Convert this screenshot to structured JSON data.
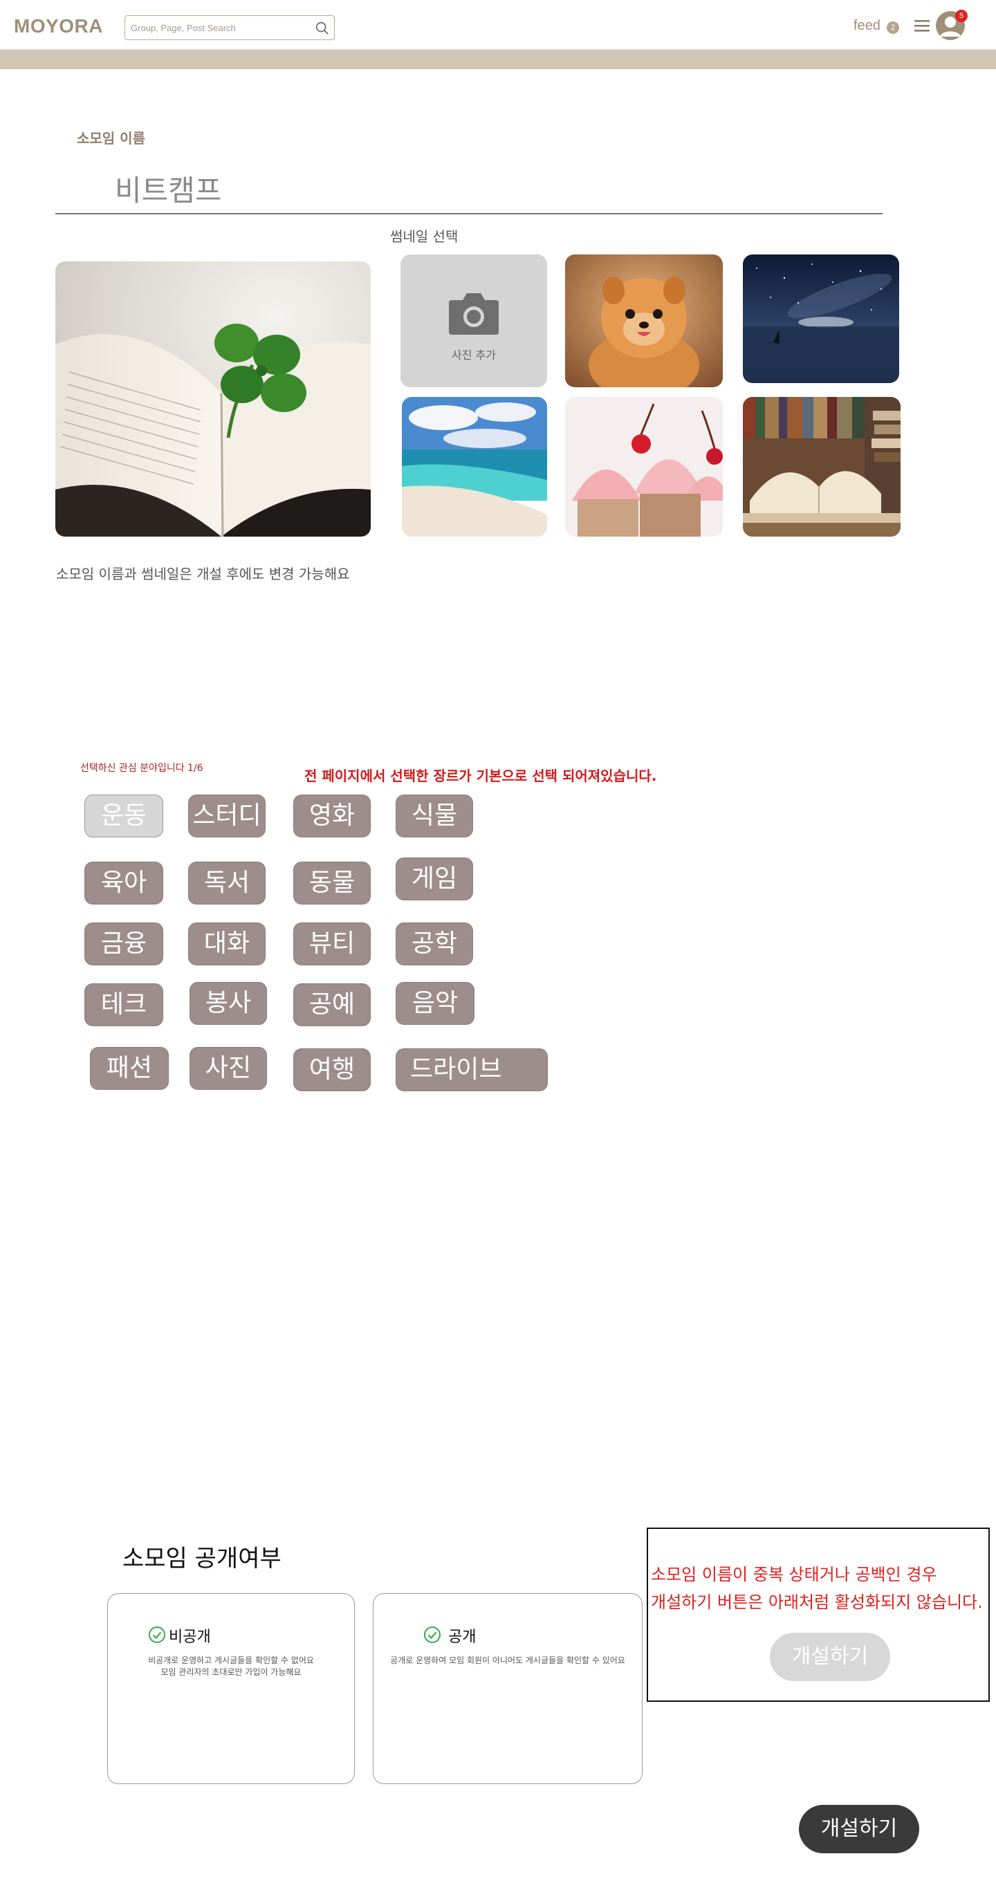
{
  "header": {
    "logo": "MOYORA",
    "search_placeholder": "Group, Page, Post Search",
    "feed_label": "feed",
    "feed_count": "2",
    "notification_count": "5"
  },
  "form": {
    "name_label": "소모임 이름",
    "name_value": "비트캠프",
    "thumbnail_label": "썸네일 선택",
    "add_photo_label": "사진 추가",
    "thumbnails": [
      "clover-book",
      "pomeranian-puppy",
      "starry-lake",
      "beach",
      "cupcakes",
      "open-books"
    ],
    "helper_text": "소모임 이름과 썸네일은 개설 후에도 변경 가능해요"
  },
  "interests": {
    "count_label": "선택하신 관심 분야입니다 1/6",
    "note": "전 페이지에서 선택한 장르가 기본으로 선택 되어져있습니다.",
    "selected": "운동",
    "chips": [
      "운동",
      "스터디",
      "영화",
      "식물",
      "육아",
      "독서",
      "동물",
      "게임",
      "금융",
      "대화",
      "뷰티",
      "공학",
      "테크",
      "봉사",
      "공예",
      "음악",
      "패션",
      "사진",
      "여행",
      "드라이브"
    ]
  },
  "visibility": {
    "title": "소모임 공개여부",
    "private": {
      "label": "비공개",
      "desc_line1": "비공개로 운영하고 게시글들을 확인할 수 없어요",
      "desc_line2": "모임 관리자의 초대로만 가입이 가능해요"
    },
    "public": {
      "label": "공개",
      "desc_line1": "공개로 운영하여 모임 회원이 아니어도 게시글들을 확인할 수 있어요"
    }
  },
  "note_box": {
    "line1": "소모임 이름이 중복 상태거나 공백인 경우",
    "line2": "개설하기 버튼은 아래처럼 활성화되지 않습니다.",
    "disabled_button": "개설하기"
  },
  "create_button": "개설하기",
  "colors": {
    "brand": "#a08f78",
    "beige_bar": "#d2c5b4",
    "chip": "#9d8d8c",
    "chip_selected": "#d6d6d6",
    "alert_red": "#e0201c",
    "button_dark": "#3a3a3a"
  }
}
